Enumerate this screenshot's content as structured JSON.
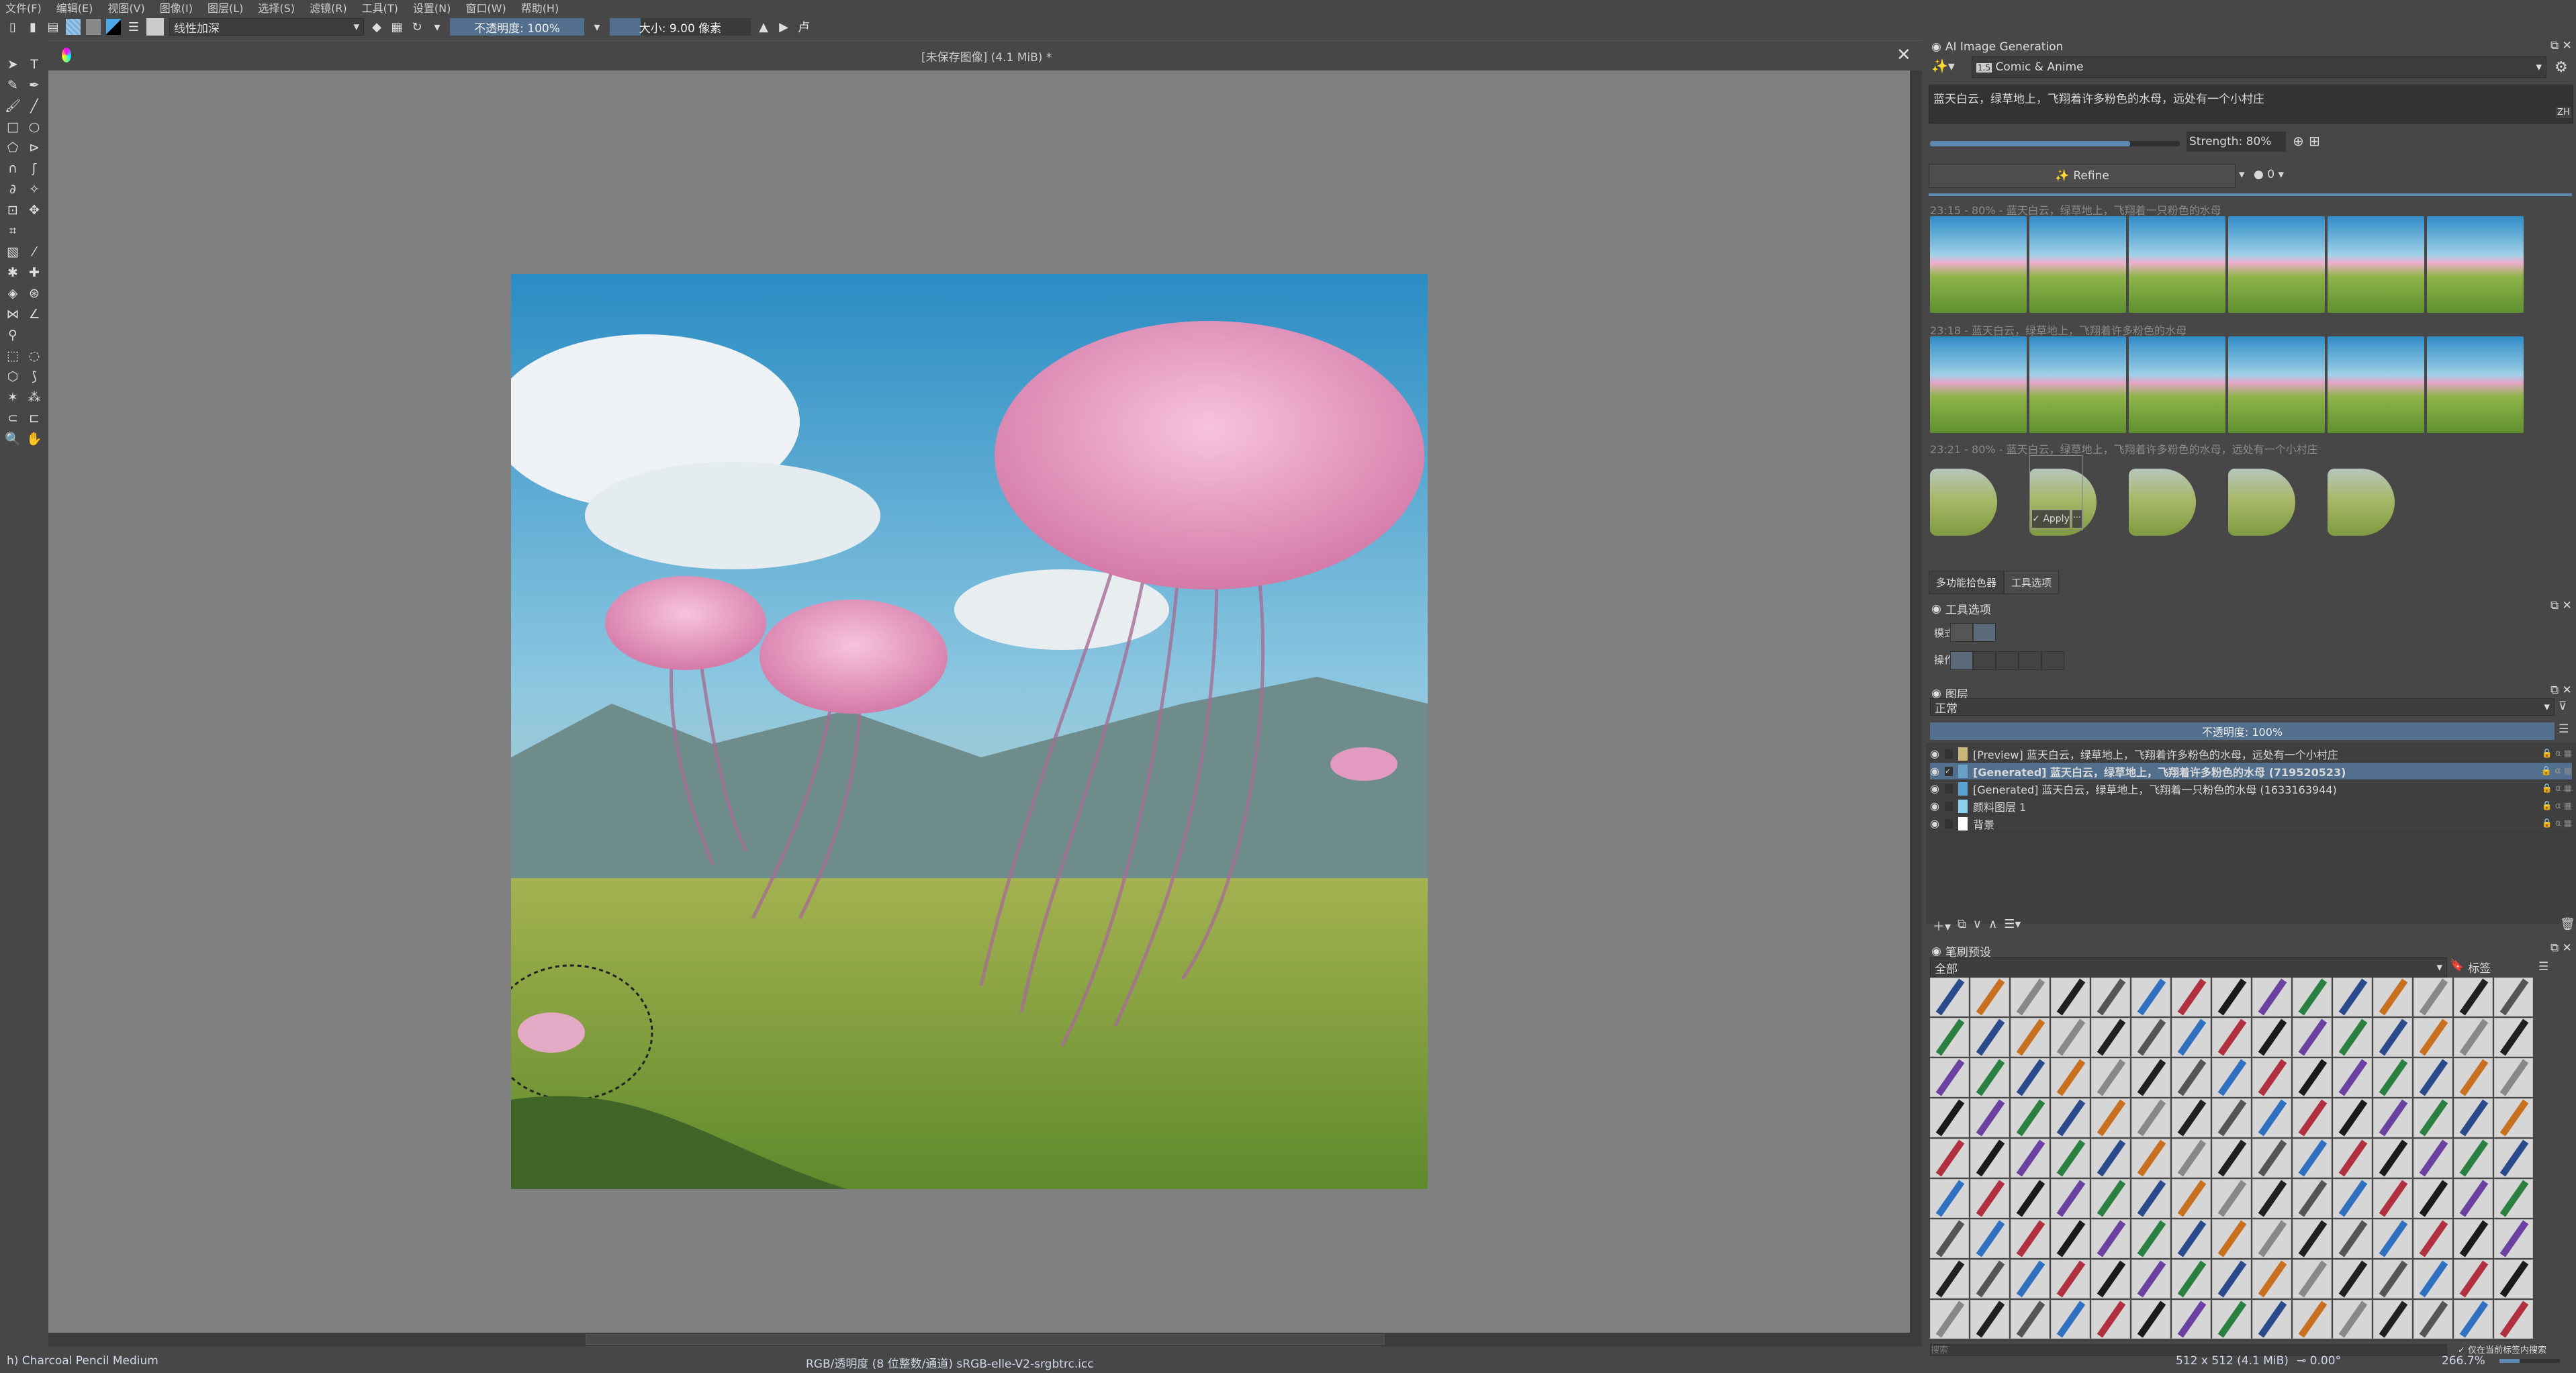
{
  "menu": [
    "文件(F)",
    "编辑(E)",
    "视图(V)",
    "图像(I)",
    "图层(L)",
    "选择(S)",
    "滤镜(R)",
    "工具(T)",
    "设置(N)",
    "窗口(W)",
    "帮助(H)"
  ],
  "toolbar": {
    "blend_mode": "线性加深",
    "opacity": "不透明度: 100%",
    "size": "大小: 9.00 像素"
  },
  "document": {
    "title": "[未保存图像]  (4.1 MiB) *"
  },
  "tools": [
    "select-icon",
    "text-icon",
    "edit-shapes-icon",
    "calligraphy-icon",
    "freehand-brush-icon",
    "line-icon",
    "rectangle-icon",
    "ellipse-icon",
    "polygon-icon",
    "polyline-icon",
    "bezier-icon",
    "freehand-path-icon",
    "dynamic-brush-icon",
    "multibrush-icon",
    "transform-icon",
    "move-icon",
    "crop-icon",
    "",
    "gradient-icon",
    "color-picker-icon",
    "colorize-mask-icon",
    "smart-patch-icon",
    "fill-icon",
    "pattern-icon",
    "assistant-icon",
    "measure-icon",
    "reference-icon",
    "",
    "rect-select-icon",
    "ellipse-select-icon",
    "polygon-select-icon",
    "freehand-select-icon",
    "contiguous-select-icon",
    "similar-select-icon",
    "bezier-select-icon",
    "magnetic-select-icon",
    "zoom-icon",
    "pan-icon"
  ],
  "ai": {
    "title": "AI Image Generation",
    "model": "Comic & Anime",
    "model_badge": "1.5",
    "prompt": "蓝天白云，绿草地上，飞翔着许多粉色的水母，远处有一个小村庄",
    "lang": "ZH",
    "strength": "Strength: 80%",
    "strength_value": 80,
    "refine": "Refine",
    "queue": "0",
    "history": [
      {
        "label": "23:15 - 80% - 蓝天白云，绿草地上，飞翔着一只粉色的水母",
        "count": 6
      },
      {
        "label": "23:18 - 蓝天白云，绿草地上，飞翔着许多粉色的水母",
        "count": 6
      },
      {
        "label": "23:21 - 80% - 蓝天白云，绿草地上，飞翔着许多粉色的水母，远处有一个小村庄",
        "count": 5
      }
    ],
    "apply": "Apply",
    "more": "..."
  },
  "tabs": [
    "多功能拾色器",
    "工具选项"
  ],
  "tool_options": {
    "title": "工具选项",
    "mode": "模式",
    "action": "操作"
  },
  "layers": {
    "title": "图层",
    "blend": "正常",
    "opacity": "不透明度: 100%",
    "items": [
      {
        "name": "[Preview] 蓝天白云，绿草地上，飞翔着许多粉色的水母，远处有一个小村庄",
        "selected": false,
        "checked": false
      },
      {
        "name": "[Generated] 蓝天白云，绿草地上，飞翔着许多粉色的水母 (719520523)",
        "selected": true,
        "checked": true
      },
      {
        "name": "[Generated] 蓝天白云，绿草地上，飞翔着一只粉色的水母 (1633163944)",
        "selected": false,
        "checked": false
      },
      {
        "name": "颜料图层 1",
        "selected": false,
        "checked": false
      },
      {
        "name": "背景",
        "selected": false,
        "checked": false
      }
    ]
  },
  "brushes": {
    "title": "笔刷预设",
    "filter": "全部",
    "tag": "标签",
    "search_placeholder": "搜索",
    "search_in_tag": "仅在当前标签内搜索"
  },
  "status": {
    "brush": "h) Charcoal Pencil Medium",
    "color": "RGB/透明度 (8 位整数/通道)  sRGB-elle-V2-srgbtrc.icc",
    "size": "512 x 512 (4.1 MiB)",
    "rotation": "0.00°",
    "zoom": "266.7%"
  },
  "colors": {
    "accent": "#52708e",
    "canvas": "#808080",
    "panel": "#474747"
  }
}
